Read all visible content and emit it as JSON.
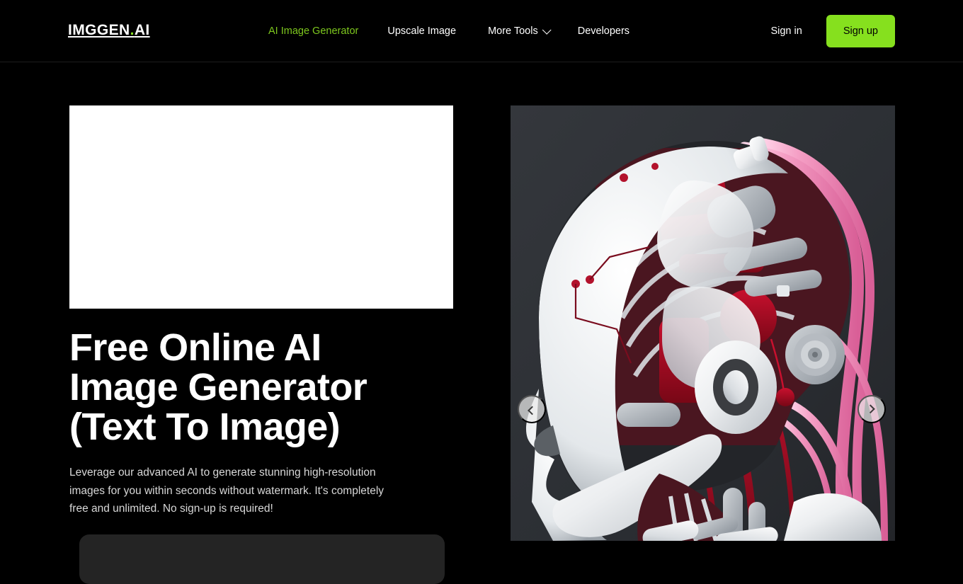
{
  "header": {
    "logo": {
      "name": "IMGGEN",
      "dot": ".",
      "suffix": "AI",
      "accent_color": "#86e01e"
    },
    "nav": [
      {
        "label": "AI Image Generator",
        "active": true
      },
      {
        "label": "Upscale Image",
        "active": false
      },
      {
        "label": "More Tools",
        "active": false,
        "icon": "chevron-down-icon"
      },
      {
        "label": "Developers",
        "active": false
      }
    ],
    "auth": {
      "signin_label": "Sign in",
      "signup_label": "Sign up",
      "signup_bg": "#86e01e",
      "signup_fg": "#000000"
    }
  },
  "hero": {
    "title": "Free Online AI Image Generator (Text To Image)",
    "subtitle": "Leverage our advanced AI to generate stunning high-resolution images for you within seconds without watermark. It's completely free and unlimited. No sign-up is required!",
    "ad_slot_label": "",
    "prompt_placeholder": ""
  },
  "carousel": {
    "prev_icon": "chevron-left-icon",
    "next_icon": "chevron-right-icon",
    "image_alt": "AI generated cyborg robotic head with white panels, crimson internal machinery and pink tubing on dark gray background",
    "background_color": "#2e3136"
  },
  "theme": {
    "page_bg": "#000000",
    "text": "#ffffff",
    "muted_text": "#d8d8d8",
    "accent": "#86e01e",
    "active_nav": "#7ec81e"
  }
}
